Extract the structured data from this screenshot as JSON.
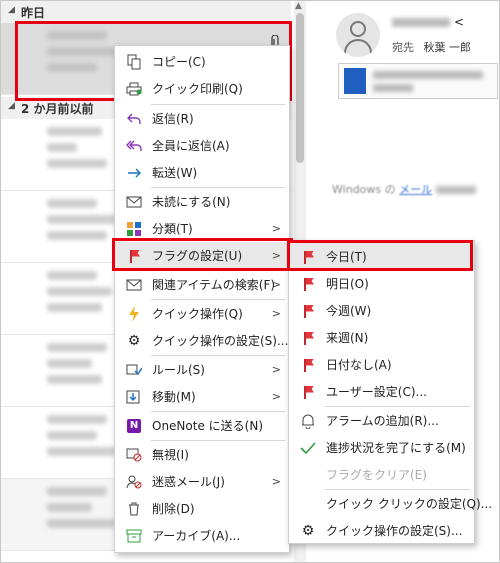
{
  "list": {
    "groups": [
      {
        "label": "昨日"
      },
      {
        "label": "2 か月前以前"
      }
    ]
  },
  "reading": {
    "to_label": "宛先",
    "to_name": "秋葉 一郎",
    "sender_suffix": "<",
    "body_prefix": "Windows の",
    "body_link": "メール"
  },
  "context_menu": {
    "items": [
      {
        "label": "コピー(C)",
        "icon": "copy-icon"
      },
      {
        "label": "クイック印刷(Q)",
        "icon": "print-icon"
      },
      {
        "label": "返信(R)",
        "icon": "reply-icon"
      },
      {
        "label": "全員に返信(A)",
        "icon": "reply-all-icon"
      },
      {
        "label": "転送(W)",
        "icon": "forward-icon"
      },
      {
        "label": "未読にする(N)",
        "icon": "mail-icon"
      },
      {
        "label": "分類(T)",
        "icon": "categorize-icon"
      },
      {
        "label": "フラグの設定(U)",
        "icon": "flag-icon"
      },
      {
        "label": "関連アイテムの検索(F)",
        "icon": "related-search-icon"
      },
      {
        "label": "クイック操作(Q)",
        "icon": "quick-step-icon"
      },
      {
        "label": "クイック操作の設定(S)...",
        "icon": "gear-icon"
      },
      {
        "label": "ルール(S)",
        "icon": "rules-icon"
      },
      {
        "label": "移動(M)",
        "icon": "move-icon"
      },
      {
        "label": "OneNote に送る(N)",
        "icon": "onenote-icon"
      },
      {
        "label": "無視(I)",
        "icon": "ignore-icon"
      },
      {
        "label": "迷惑メール(J)",
        "icon": "junk-icon"
      },
      {
        "label": "削除(D)",
        "icon": "delete-icon"
      },
      {
        "label": "アーカイブ(A)...",
        "icon": "archive-icon"
      }
    ]
  },
  "flag_submenu": {
    "items": [
      {
        "label": "今日(T)"
      },
      {
        "label": "明日(O)"
      },
      {
        "label": "今週(W)"
      },
      {
        "label": "来週(N)"
      },
      {
        "label": "日付なし(A)"
      },
      {
        "label": "ユーザー設定(C)..."
      },
      {
        "label": "アラームの追加(R)..."
      },
      {
        "label": "進捗状況を完了にする(M)"
      },
      {
        "label": "フラグをクリア(E)"
      },
      {
        "label": "クイック クリックの設定(Q)..."
      },
      {
        "label": "クイック操作の設定(S)..."
      }
    ]
  },
  "colors": {
    "highlight_border": "#e60012",
    "flag_red": "#e0363c",
    "check_green": "#2e9d3f"
  }
}
